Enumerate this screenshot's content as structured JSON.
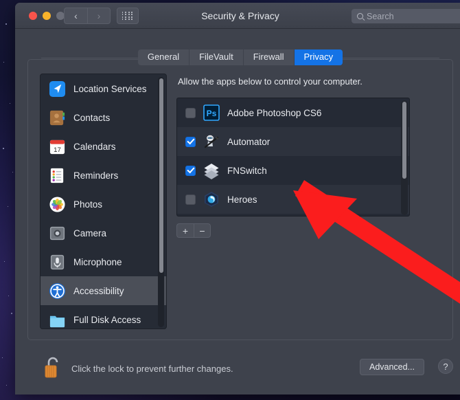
{
  "window": {
    "title": "Security & Privacy",
    "traffic_lights": [
      "close-red",
      "minimize-yellow",
      "zoom-gray-disabled"
    ],
    "back_glyph": "‹",
    "forward_glyph": "›",
    "grid_button": "show-all-grid"
  },
  "search": {
    "placeholder": "Search",
    "value": ""
  },
  "tabs": [
    {
      "label": "General",
      "active": false
    },
    {
      "label": "FileVault",
      "active": false
    },
    {
      "label": "Firewall",
      "active": false
    },
    {
      "label": "Privacy",
      "active": true
    }
  ],
  "sidebar": {
    "items": [
      {
        "label": "Location Services",
        "icon": "location-services-icon",
        "selected": false
      },
      {
        "label": "Contacts",
        "icon": "contacts-icon",
        "selected": false
      },
      {
        "label": "Calendars",
        "icon": "calendars-icon",
        "selected": false
      },
      {
        "label": "Reminders",
        "icon": "reminders-icon",
        "selected": false
      },
      {
        "label": "Photos",
        "icon": "photos-icon",
        "selected": false
      },
      {
        "label": "Camera",
        "icon": "camera-icon",
        "selected": false
      },
      {
        "label": "Microphone",
        "icon": "microphone-icon",
        "selected": false
      },
      {
        "label": "Accessibility",
        "icon": "accessibility-icon",
        "selected": true
      },
      {
        "label": "Full Disk Access",
        "icon": "full-disk-access-icon",
        "selected": false
      }
    ]
  },
  "main": {
    "allow_text": "Allow the apps below to control your computer.",
    "apps": [
      {
        "name": "Adobe Photoshop CS6",
        "checked": false,
        "icon": "photoshop-icon"
      },
      {
        "name": "Automator",
        "checked": true,
        "icon": "automator-icon"
      },
      {
        "name": "FNSwitch",
        "checked": true,
        "icon": "fnswitch-icon"
      },
      {
        "name": "Heroes",
        "checked": false,
        "icon": "heroes-icon"
      }
    ],
    "add_label": "+",
    "remove_label": "−"
  },
  "bottom": {
    "lock_text": "Click the lock to prevent further changes.",
    "lock_state": "unlocked",
    "advanced_label": "Advanced...",
    "help_label": "?"
  },
  "annotation": {
    "type": "red-arrow",
    "color": "#fb1d1d",
    "points_to": "FNSwitch"
  },
  "colors": {
    "accent_blue": "#1473e6",
    "window_bg": "#3e424c",
    "list_bg": "#252a35",
    "sidebar_bg": "#262b35"
  }
}
